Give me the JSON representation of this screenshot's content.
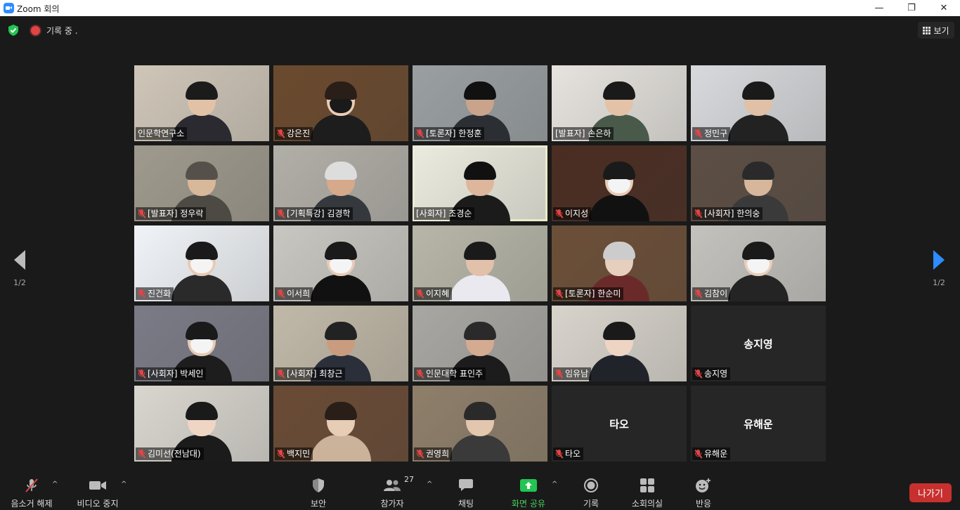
{
  "window": {
    "title": "Zoom 회의"
  },
  "topbar": {
    "recording": "기록 중 .",
    "view": "보기"
  },
  "pager": {
    "left_label": "1/2",
    "right_label": "1/2"
  },
  "participants": [
    {
      "label": "인문학연구소",
      "mic_off": false
    },
    {
      "label": "강은진",
      "mic_off": true
    },
    {
      "label": "[토론자] 한정훈",
      "mic_off": true
    },
    {
      "label": "[발표자] 손은하",
      "mic_off": false
    },
    {
      "label": "정민구",
      "mic_off": true
    },
    {
      "label": "[발표자] 정우락",
      "mic_off": true
    },
    {
      "label": "[기획특강] 김경학",
      "mic_off": true
    },
    {
      "label": "[사회자] 조경순",
      "mic_off": false
    },
    {
      "label": "이지성",
      "mic_off": true
    },
    {
      "label": "[사회자] 한의숭",
      "mic_off": true
    },
    {
      "label": "진건화",
      "mic_off": true
    },
    {
      "label": "이서희",
      "mic_off": true
    },
    {
      "label": "이지혜",
      "mic_off": true
    },
    {
      "label": "[토론자] 한순미",
      "mic_off": true
    },
    {
      "label": "김참이",
      "mic_off": true
    },
    {
      "label": "[사회자] 박세인",
      "mic_off": true
    },
    {
      "label": "[사회자] 최창근",
      "mic_off": true
    },
    {
      "label": "인문대학 표인주",
      "mic_off": true
    },
    {
      "label": "임유남",
      "mic_off": true
    },
    {
      "label": "송지영",
      "mic_off": true,
      "no_video": true
    },
    {
      "label": "김미선(전남대)",
      "mic_off": true
    },
    {
      "label": "백지민",
      "mic_off": true
    },
    {
      "label": "권영희",
      "mic_off": true
    },
    {
      "label": "타오",
      "mic_off": true,
      "no_video": true
    },
    {
      "label": "유해운",
      "mic_off": true,
      "no_video": true
    }
  ],
  "toolbar": {
    "unmute": "음소거 해제",
    "stop_video": "비디오 중지",
    "security": "보안",
    "participants": "참가자",
    "participants_count": "27",
    "chat": "채팅",
    "share_screen": "화면 공유",
    "record": "기록",
    "breakout": "소회의실",
    "reactions": "반응",
    "leave": "나가기"
  },
  "colors": {
    "accent": "#2d8cff",
    "share_green": "#49d15b",
    "leave_red": "#c8302f",
    "active_speaker": "#dde94d"
  }
}
